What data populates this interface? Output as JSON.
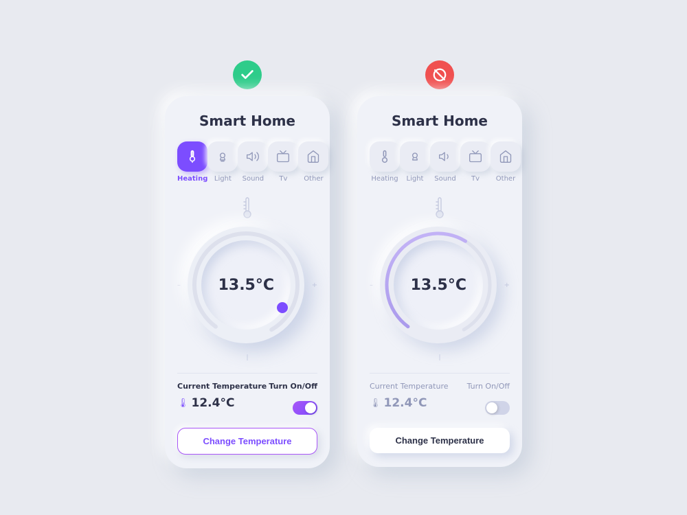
{
  "app": {
    "title": "Smart Home",
    "bg": "#e8eaf0"
  },
  "phones": [
    {
      "id": "phone-active",
      "status_icon": "check",
      "status_class": "active",
      "title": "Smart Home",
      "tabs": [
        {
          "id": "heating",
          "label": "Heating",
          "icon": "thermometer",
          "active": true
        },
        {
          "id": "light",
          "label": "Light",
          "icon": "bulb",
          "active": false
        },
        {
          "id": "sound",
          "label": "Sound",
          "icon": "speaker",
          "active": false
        },
        {
          "id": "tv",
          "label": "Tv",
          "icon": "tv",
          "active": false
        },
        {
          "id": "other",
          "label": "Other",
          "icon": "home",
          "active": false
        }
      ],
      "dial_temp": "13.5°C",
      "has_arc": true,
      "current_temp_label": "Current Temperature",
      "current_temp_val": "12.4°C",
      "toggle_on": true,
      "toggle_label": "Turn On/Off",
      "btn_label": "Change Temperature",
      "btn_class": "active"
    },
    {
      "id": "phone-inactive",
      "status_icon": "ban",
      "status_class": "inactive",
      "title": "Smart Home",
      "tabs": [
        {
          "id": "heating",
          "label": "Heating",
          "icon": "thermometer",
          "active": false
        },
        {
          "id": "light",
          "label": "Light",
          "icon": "bulb",
          "active": false
        },
        {
          "id": "sound",
          "label": "Sound",
          "icon": "speaker",
          "active": false
        },
        {
          "id": "tv",
          "label": "Tv",
          "icon": "tv",
          "active": false
        },
        {
          "id": "other",
          "label": "Other",
          "icon": "home",
          "active": false
        }
      ],
      "dial_temp": "13.5°C",
      "has_arc": true,
      "arc_partial": true,
      "current_temp_label": "Current Temperature",
      "current_temp_val": "12.4°C",
      "toggle_on": false,
      "toggle_label": "Turn On/Off",
      "btn_label": "Change Temperature",
      "btn_class": "inactive"
    }
  ],
  "icons": {
    "check": "✓",
    "ban": "⊘"
  }
}
